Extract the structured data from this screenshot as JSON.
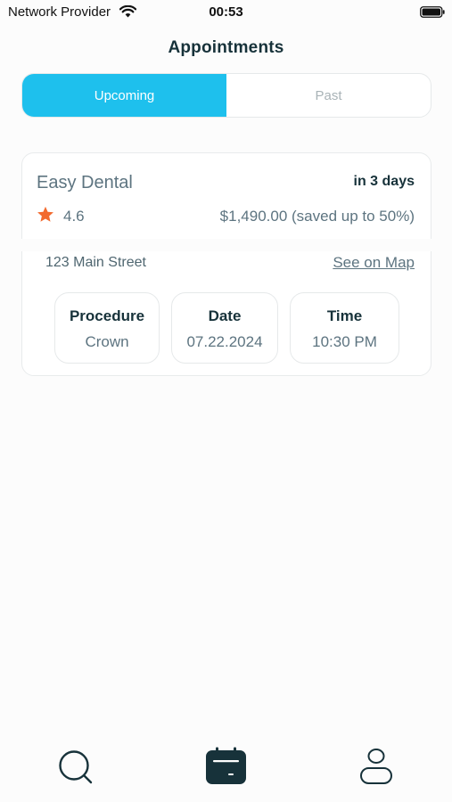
{
  "status_bar": {
    "carrier": "Network Provider",
    "time": "00:53",
    "icons": [
      "wifi-icon",
      "battery-icon"
    ]
  },
  "header": {
    "title": "Appointments"
  },
  "tabs": {
    "items": [
      {
        "label": "Upcoming",
        "active": true
      },
      {
        "label": "Past",
        "active": false
      }
    ]
  },
  "appointment": {
    "clinic_name": "Easy Dental",
    "due": "in 3 days",
    "rating": "4.6",
    "price": "$1,490.00 (saved up to 50%)",
    "address": "123 Main Street",
    "map_link": "See on Map",
    "details": [
      {
        "label": "Procedure",
        "value": "Crown"
      },
      {
        "label": "Date",
        "value": "07.22.2024"
      },
      {
        "label": "Time",
        "value": "10:30 PM"
      }
    ]
  },
  "bottom_nav": {
    "items": [
      {
        "icon": "search-icon",
        "active": false
      },
      {
        "icon": "calendar-icon",
        "active": true
      },
      {
        "icon": "profile-icon",
        "active": false
      }
    ]
  },
  "colors": {
    "accent": "#1ec0ed",
    "dark": "#17323a",
    "muted": "#5d7480",
    "star": "#f26a2e"
  }
}
